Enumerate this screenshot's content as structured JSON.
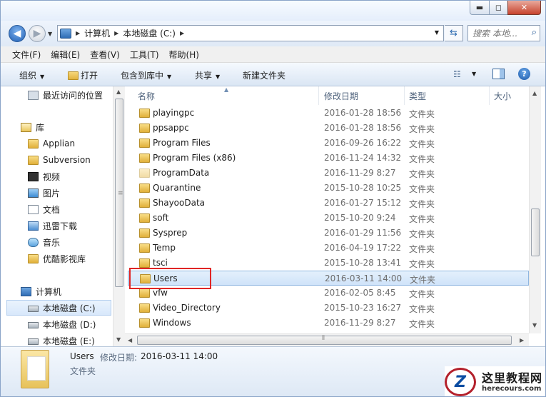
{
  "window": {
    "min_glyph": "▬",
    "max_glyph": "◻",
    "close_glyph": "✕"
  },
  "address": {
    "crumbs": [
      "计算机",
      "本地磁盘 (C:)"
    ]
  },
  "search": {
    "placeholder": "搜索 本地..."
  },
  "menu": [
    "文件(F)",
    "编辑(E)",
    "查看(V)",
    "工具(T)",
    "帮助(H)"
  ],
  "commands": {
    "organize": "组织",
    "open": "打开",
    "include": "包含到库中",
    "share": "共享",
    "newfolder": "新建文件夹"
  },
  "nav": {
    "recent": "最近访问的位置",
    "library": "库",
    "applian": "Applian",
    "subversion": "Subversion",
    "videos": "视频",
    "pictures": "图片",
    "documents": "文档",
    "thunder": "迅雷下载",
    "music": "音乐",
    "youku": "优酷影视库",
    "computer": "计算机",
    "drive_c": "本地磁盘 (C:)",
    "drive_d": "本地磁盘 (D:)",
    "drive_e": "本地磁盘 (E:)"
  },
  "columns": {
    "name": "名称",
    "date": "修改日期",
    "type": "类型",
    "size": "大小"
  },
  "files": [
    {
      "name": "playingpc",
      "date": "2016-01-28 18:56",
      "type": "文件夹"
    },
    {
      "name": "ppsappc",
      "date": "2016-01-28 18:56",
      "type": "文件夹"
    },
    {
      "name": "Program Files",
      "date": "2016-09-26 16:22",
      "type": "文件夹"
    },
    {
      "name": "Program Files (x86)",
      "date": "2016-11-24 14:32",
      "type": "文件夹"
    },
    {
      "name": "ProgramData",
      "date": "2016-11-29 8:27",
      "type": "文件夹"
    },
    {
      "name": "Quarantine",
      "date": "2015-10-28 10:25",
      "type": "文件夹"
    },
    {
      "name": "ShayooData",
      "date": "2016-01-27 15:12",
      "type": "文件夹"
    },
    {
      "name": "soft",
      "date": "2015-10-20 9:24",
      "type": "文件夹"
    },
    {
      "name": "Sysprep",
      "date": "2016-01-29 11:56",
      "type": "文件夹"
    },
    {
      "name": "Temp",
      "date": "2016-04-19 17:22",
      "type": "文件夹"
    },
    {
      "name": "tsci",
      "date": "2015-10-28 13:41",
      "type": "文件夹"
    },
    {
      "name": "Users",
      "date": "2016-03-11 14:00",
      "type": "文件夹"
    },
    {
      "name": "vfw",
      "date": "2016-02-05 8:45",
      "type": "文件夹"
    },
    {
      "name": "Video_Directory",
      "date": "2015-10-23 16:27",
      "type": "文件夹"
    },
    {
      "name": "Windows",
      "date": "2016-11-29 8:27",
      "type": "文件夹"
    }
  ],
  "details": {
    "name": "Users",
    "modified_label": "修改日期:",
    "modified_value": "2016-03-11 14:00",
    "type": "文件夹"
  },
  "watermark": {
    "logo": "Z",
    "title": "这里教程网",
    "url": "herecours.com"
  },
  "colors": {
    "selection": "#cfe3f9",
    "highlight_box": "#e02525"
  }
}
